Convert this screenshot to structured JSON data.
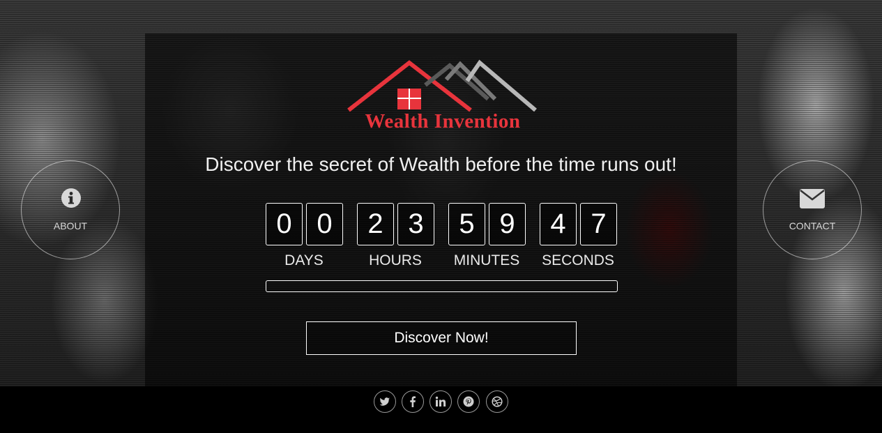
{
  "brand": {
    "name": "Wealth Invention",
    "accent_color": "#e8343c"
  },
  "tagline": "Discover the secret of Wealth before the time runs out!",
  "countdown": {
    "days": [
      "0",
      "0"
    ],
    "hours": [
      "2",
      "3"
    ],
    "minutes": [
      "5",
      "9"
    ],
    "seconds": [
      "4",
      "7"
    ],
    "labels": {
      "days": "DAYS",
      "hours": "HOURS",
      "minutes": "MINUTES",
      "seconds": "SECONDS"
    }
  },
  "progress": {
    "fraction": 0.0
  },
  "cta": {
    "label": "Discover Now!"
  },
  "side_buttons": {
    "about": {
      "label": "ABOUT",
      "icon": "info-icon"
    },
    "contact": {
      "label": "CONTACT",
      "icon": "envelope-icon"
    }
  },
  "social": [
    {
      "name": "twitter",
      "icon": "twitter-icon"
    },
    {
      "name": "facebook",
      "icon": "facebook-icon"
    },
    {
      "name": "linkedin",
      "icon": "linkedin-icon"
    },
    {
      "name": "pinterest",
      "icon": "pinterest-icon"
    },
    {
      "name": "dribbble",
      "icon": "dribbble-icon"
    }
  ]
}
